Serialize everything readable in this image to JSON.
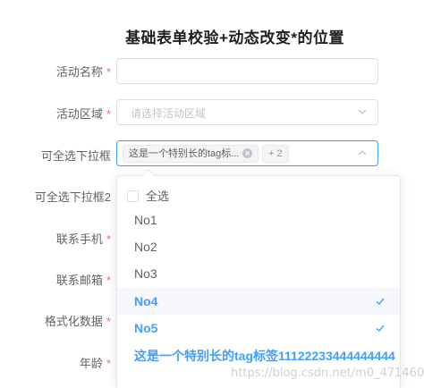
{
  "form": {
    "title": "基础表单校验+动态改变*的位置",
    "required_mark": "*",
    "fields": [
      {
        "label": "活动名称",
        "required": true
      },
      {
        "label": "活动区域",
        "required": true,
        "placeholder": "请选择活动区域"
      },
      {
        "label": "可全选下拉框",
        "required": false
      },
      {
        "label": "可全选下拉框2",
        "required": false
      },
      {
        "label": "联系手机",
        "required": true
      },
      {
        "label": "联系邮箱",
        "required": true
      },
      {
        "label": "格式化数据",
        "required": true
      },
      {
        "label": "年龄",
        "required": true
      }
    ]
  },
  "multiselect": {
    "tag_label": "这是一个特别长的tag标...",
    "more_label": "+ 2"
  },
  "dropdown": {
    "select_all_label": "全选",
    "options": [
      {
        "label": "No1",
        "selected": false
      },
      {
        "label": "No2",
        "selected": false
      },
      {
        "label": "No3",
        "selected": false
      },
      {
        "label": "No4",
        "selected": true
      },
      {
        "label": "No5",
        "selected": true
      },
      {
        "label": "这是一个特别长的tag标签11122233444444444",
        "selected": true
      }
    ]
  },
  "watermark": "https://blog.csdn.net/m0_47146037",
  "colors": {
    "primary": "#409eff",
    "required": "#f56c6c",
    "border": "#dcdfe6",
    "text": "#606266",
    "placeholder": "#c0c4cc"
  }
}
